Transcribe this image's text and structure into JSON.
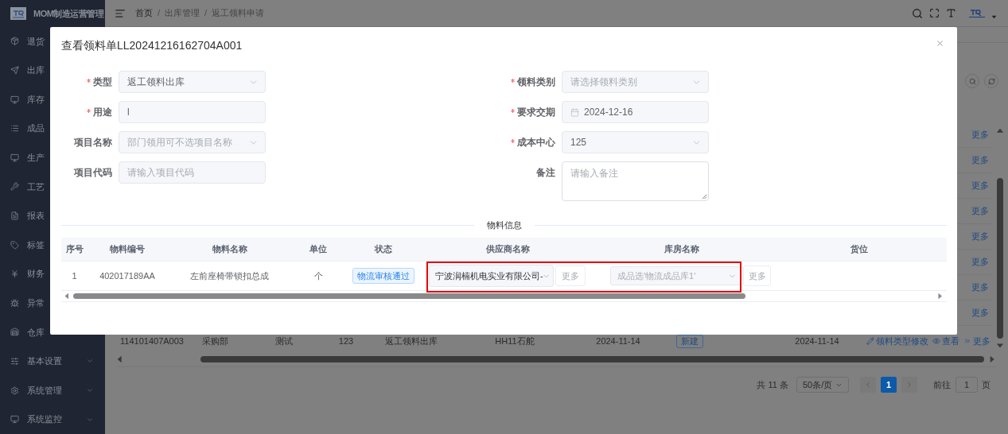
{
  "sidebar": {
    "title": "MOM制造运营管理",
    "items": [
      {
        "label": "退货"
      },
      {
        "label": "出库"
      },
      {
        "label": "库存"
      },
      {
        "label": "成品"
      },
      {
        "label": "生产"
      },
      {
        "label": "工艺"
      },
      {
        "label": "报表"
      },
      {
        "label": "标签"
      },
      {
        "label": "财务"
      },
      {
        "label": "异常"
      },
      {
        "label": "仓库"
      },
      {
        "label": "基本设置",
        "expandable": true
      },
      {
        "label": "系统管理",
        "expandable": true
      },
      {
        "label": "系统监控",
        "expandable": true
      }
    ]
  },
  "header": {
    "breadcrumb": [
      "首页",
      "出库管理",
      "返工领料申请"
    ],
    "separator": "/"
  },
  "background_table": {
    "row_links": [
      "更多",
      "更多",
      "更多",
      "更多",
      "更多",
      "更多",
      "更多",
      "更多"
    ],
    "last_row": {
      "cells": [
        "114101407A003",
        "采购部",
        "测试",
        "123",
        "返工领料出库",
        "HH11石舵",
        "2024-11-14"
      ],
      "status": "新建",
      "date": "2024-11-14",
      "actions": [
        "领料类型修改",
        "查看",
        "更多"
      ]
    }
  },
  "pagination": {
    "total": "共 11 条",
    "page_size": "50条/页",
    "pages": [
      {
        "label": "1",
        "selected": true
      }
    ],
    "goto_label": "前往",
    "goto_value": "1",
    "goto_suffix": "页"
  },
  "dialog": {
    "title": "查看领料单LL20241216162704A001",
    "left_fields": [
      {
        "label": "类型",
        "required": true,
        "kind": "select",
        "value": "返工领料出库"
      },
      {
        "label": "用途",
        "required": true,
        "kind": "input",
        "value": "l"
      },
      {
        "label": "项目名称",
        "required": false,
        "kind": "select",
        "placeholder": "部门领用可不选项目名称"
      },
      {
        "label": "项目代码",
        "required": false,
        "kind": "input",
        "placeholder": "请输入项目代码"
      }
    ],
    "right_fields": [
      {
        "label": "领料类别",
        "required": true,
        "kind": "select",
        "placeholder": "请选择领料类别"
      },
      {
        "label": "要求交期",
        "required": true,
        "kind": "date",
        "value": "2024-12-16"
      },
      {
        "label": "成本中心",
        "required": true,
        "kind": "select",
        "value": "125"
      },
      {
        "label": "备注",
        "required": false,
        "kind": "textarea",
        "placeholder": "请输入备注"
      }
    ],
    "section_title": "物料信息",
    "table": {
      "columns": [
        "序号",
        "物料编号",
        "物料名称",
        "单位",
        "状态",
        "供应商名称",
        "库房名称",
        "货位"
      ],
      "rows": [
        {
          "index": "1",
          "code": "402017189AA",
          "name": "左前座椅带锁扣总成",
          "unit": "个",
          "status": "物流审核通过",
          "supplier": {
            "value": "宁波润楠机电实业有限公司-"
          },
          "supplier_button": "更多",
          "warehouse": {
            "placeholder": "成品选'物流成品库1'"
          },
          "warehouse_button": "更多"
        }
      ],
      "highlight_frame": true
    }
  }
}
